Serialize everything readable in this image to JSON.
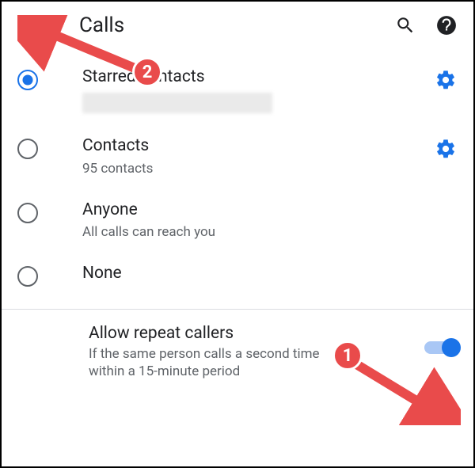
{
  "header": {
    "title": "Calls"
  },
  "options": [
    {
      "label": "Starred contacts",
      "sub": "",
      "selected": true,
      "gear": true,
      "blurred": true
    },
    {
      "label": "Contacts",
      "sub": "95 contacts",
      "selected": false,
      "gear": true
    },
    {
      "label": "Anyone",
      "sub": "All calls can reach you",
      "selected": false,
      "gear": false
    },
    {
      "label": "None",
      "sub": "",
      "selected": false,
      "gear": false
    }
  ],
  "repeat": {
    "label": "Allow repeat callers",
    "sub": "If the same person calls a second time within a 15-minute period",
    "enabled": true
  },
  "annotations": {
    "badge1": "1",
    "badge2": "2"
  },
  "colors": {
    "accent": "#1a73e8",
    "annotation": "#e94b4b"
  }
}
